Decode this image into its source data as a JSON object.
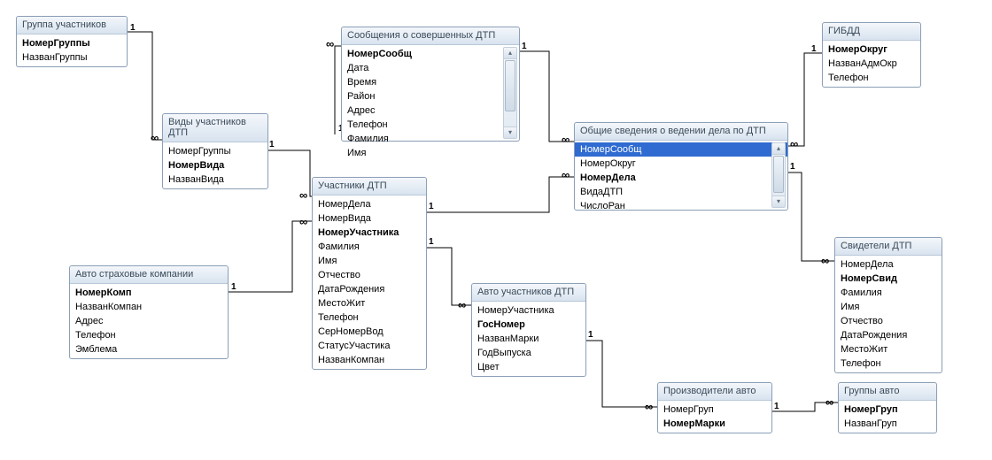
{
  "boxes": [
    {
      "title": "Группа участников",
      "fields": [
        {
          "name": "НомерГруппы",
          "pk": true
        },
        {
          "name": "НазванГруппы"
        }
      ]
    },
    {
      "title": "Виды участников ДТП",
      "fields": [
        {
          "name": "НомерГруппы"
        },
        {
          "name": "НомерВида",
          "pk": true
        },
        {
          "name": "НазванВида"
        }
      ]
    },
    {
      "title": "Сообщения о совершенных ДТП",
      "fields": [
        {
          "name": "НомерСообщ",
          "pk": true
        },
        {
          "name": "Дата"
        },
        {
          "name": "Время"
        },
        {
          "name": "Район"
        },
        {
          "name": "Адрес"
        },
        {
          "name": "Телефон"
        },
        {
          "name": "Фамилия"
        },
        {
          "name": "Имя"
        }
      ],
      "scroll": true
    },
    {
      "title": "ГИБДД",
      "fields": [
        {
          "name": "НомерОкруг",
          "pk": true
        },
        {
          "name": "НазванАдмОкр"
        },
        {
          "name": "Телефон"
        }
      ]
    },
    {
      "title": "Общие сведения о ведении дела по ДТП",
      "fields": [
        {
          "name": "НомерСообщ",
          "selected": true
        },
        {
          "name": "НомерОкруг"
        },
        {
          "name": "НомерДела",
          "pk": true
        },
        {
          "name": "ВидаДТП"
        },
        {
          "name": "ЧислоРан"
        }
      ],
      "scroll": true
    },
    {
      "title": "Участники ДТП",
      "fields": [
        {
          "name": "НомерДела"
        },
        {
          "name": "НомерВида"
        },
        {
          "name": "НомерУчастника",
          "pk": true
        },
        {
          "name": "Фамилия"
        },
        {
          "name": "Имя"
        },
        {
          "name": "Отчество"
        },
        {
          "name": "ДатаРождения"
        },
        {
          "name": "МестоЖит"
        },
        {
          "name": "Телефон"
        },
        {
          "name": "СерНомерВод"
        },
        {
          "name": "СтатусУчастика"
        },
        {
          "name": "НазванКомпан"
        }
      ]
    },
    {
      "title": "Авто страховые компании",
      "fields": [
        {
          "name": "НомерКомп",
          "pk": true
        },
        {
          "name": "НазванКомпан"
        },
        {
          "name": "Адрес"
        },
        {
          "name": "Телефон"
        },
        {
          "name": "Эмблема"
        }
      ]
    },
    {
      "title": "Авто участников ДТП",
      "fields": [
        {
          "name": "НомерУчастника"
        },
        {
          "name": "ГосНомер",
          "pk": true
        },
        {
          "name": "НазванМарки"
        },
        {
          "name": "ГодВыпуска"
        },
        {
          "name": "Цвет"
        }
      ]
    },
    {
      "title": "Свидетели ДТП",
      "fields": [
        {
          "name": "НомерДела"
        },
        {
          "name": "НомерСвид",
          "pk": true
        },
        {
          "name": "Фамилия"
        },
        {
          "name": "Имя"
        },
        {
          "name": "Отчество"
        },
        {
          "name": "ДатаРождения"
        },
        {
          "name": "МестоЖит"
        },
        {
          "name": "Телефон"
        }
      ]
    },
    {
      "title": "Производители авто",
      "fields": [
        {
          "name": "НомерГруп"
        },
        {
          "name": "НомерМарки",
          "pk": true
        }
      ]
    },
    {
      "title": "Группы авто",
      "fields": [
        {
          "name": "НомерГруп",
          "pk": true
        },
        {
          "name": "НазванГруп"
        }
      ]
    }
  ],
  "relationships": [
    {
      "from": "Группа участников",
      "to": "Виды участников ДТП",
      "card": "1:∞"
    },
    {
      "from": "Виды участников ДТП",
      "to": "Участники ДТП",
      "card": "1:∞"
    },
    {
      "from": "Сообщения о совершенных ДТП",
      "to": "Общие сведения о ведении дела по ДТП",
      "card": "1:∞"
    },
    {
      "from": "ГИБДД",
      "to": "Общие сведения о ведении дела по ДТП",
      "card": "1:∞"
    },
    {
      "from": "Общие сведения о ведении дела по ДТП",
      "to": "Участники ДТП",
      "card": "1:∞"
    },
    {
      "from": "Общие сведения о ведении дела по ДТП",
      "to": "Свидетели ДТП",
      "card": "1:∞"
    },
    {
      "from": "Авто страховые компании",
      "to": "Участники ДТП",
      "card": "1:∞"
    },
    {
      "from": "Участники ДТП",
      "to": "Авто участников ДТП",
      "card": "1:∞"
    },
    {
      "from": "Авто участников ДТП",
      "to": "Производители авто",
      "card": "1:∞"
    },
    {
      "from": "Группы авто",
      "to": "Производители авто",
      "card": "1:∞"
    }
  ]
}
